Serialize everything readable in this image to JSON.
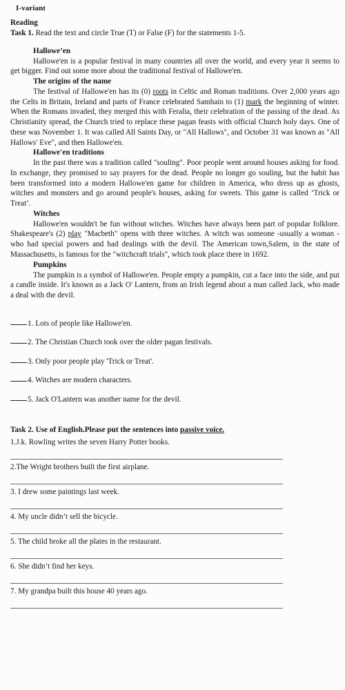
{
  "document": {
    "variant_label": "I-variant",
    "section_heading": "Reading",
    "task1": {
      "label": "Task 1.",
      "instruction": " Read the text and circle True (T) or False (F) for the statements 1-5."
    },
    "article": {
      "title": "Hallowe’en",
      "intro": "Hallowe'en is a popular festival in many countries all over the world, and every year it seems to get bigger. Find out some more about the traditional festival of Hallowe'en.",
      "sections": [
        {
          "heading": "The origins of the name",
          "text_before": "The festival of Hallowe'en has its (0) ",
          "underlined_1": "roots",
          "text_middle": " in Celtic and Roman traditions. Over 2,000 years ago the Celts in Britain, Ireland and parts of France celebrated Samhain to (1) ",
          "underlined_2": "mark",
          "text_after": " the beginning of winter. When the Romans invaded, they merged this with Feralia, their celebration of the passing of the dead. As Christianity spread, the Church tried to replace these pagan feasts with official Church holy days. One of these was November 1. It was called All Saints Day, or \"All Hallows\", and October 31 was known as \"All Hallows' Eve\", and then Hallowe'en."
        },
        {
          "heading": "Hallowe'en traditions",
          "text": "In the past there was a tradition called \"souling\". Poor people went around houses asking for food. In exchange, they promised to say prayers for the dead. People no longer go souling, but the habit has been transformed into a modern Hallowe'en game for children in America, who dress up as ghosts, witches and monsters and go around people's houses, asking for sweets. This game is called ‘Trick or Treat’."
        },
        {
          "heading": "Witches",
          "text_before": "Hallowe'en wouldn't be fun without witches. Witches have always been part of popular folklore. Shakespeare's (2) ",
          "underlined_1": "play",
          "text_after": " \"Macbeth\" opens with three witches. A witch was someone -usually a woman - who had special powers and had dealings with the devil. The American town,Salem, in the state of Massachusetts, is famous for the \"witchcraft trials\", which took place there in 1692."
        },
        {
          "heading": "Pumpkins",
          "text": "The pumpkin is a symbol of Hallowe'en. People empty a pumpkin, cut a face into the side, and put a candle inside. It's known as a Jack O' Lantern, from an Irish legend about a man called Jack, who made a deal with the devil."
        }
      ]
    },
    "statements": [
      {
        "number": "1.",
        "text": " Lots of people like Hallowe'en."
      },
      {
        "number": "2.",
        "text": " The Christian Church took over the older pagan festivals."
      },
      {
        "number": "3.",
        "text": " Only poor people play 'Trick or Treat'."
      },
      {
        "number": "4.",
        "text": " Witches are modern characters."
      },
      {
        "number": "5.",
        "text": " Jack O'Lantern was another name for the devil."
      }
    ],
    "task2": {
      "heading_before": "Task 2. Use of English.Please put the sentences into ",
      "heading_underlined": "passive voice.",
      "questions": [
        {
          "text": "1.J.k. Rowling writes the seven Harry Potter books."
        },
        {
          "text": "2.The Wright brothers built the first airplane."
        },
        {
          "text": "3. I drew some paintings last week."
        },
        {
          "text": "4.   My uncle didn’t sell the bicycle."
        },
        {
          "text": "5. The child broke all the plates in the restaurant."
        },
        {
          "text": "6.   She didn’t find her keys."
        },
        {
          "text": "7. My grandpa built this house 40 years ago."
        }
      ]
    }
  }
}
